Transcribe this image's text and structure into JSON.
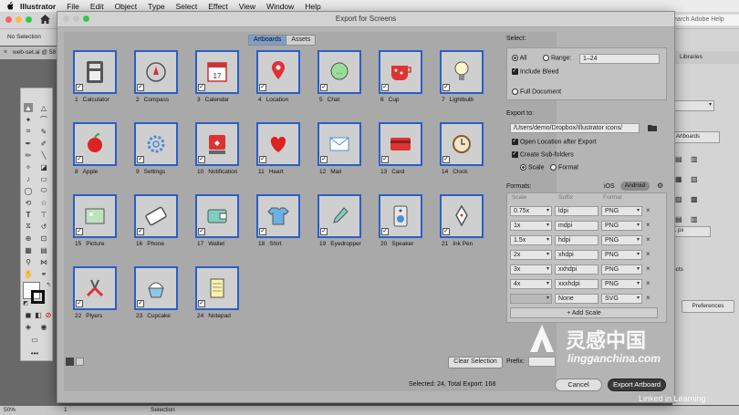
{
  "menubar": {
    "app_name": "Illustrator",
    "items": [
      "File",
      "Edit",
      "Object",
      "Type",
      "Select",
      "Effect",
      "View",
      "Window",
      "Help"
    ]
  },
  "appbar": {
    "search_placeholder": "earch Adobe Help"
  },
  "controlbar": {
    "selection_text": "No Selection"
  },
  "document_tab": {
    "label": "web-set.ai @ 58"
  },
  "rightpanel": {
    "libraries_label": "Libraries",
    "artboards_btn": "t Artboards",
    "px_value": "1 px",
    "ects_label": "ects",
    "preferences_btn": "Preferences"
  },
  "statusbar": {
    "zoom": "50%",
    "page": "1",
    "mode": "Selection"
  },
  "dialog": {
    "title": "Export for Screens",
    "tabs": [
      {
        "label": "Artboards",
        "active": true
      },
      {
        "label": "Assets",
        "active": false
      }
    ],
    "artboards": [
      {
        "num": "1",
        "name": "Calculator"
      },
      {
        "num": "2",
        "name": "Compass"
      },
      {
        "num": "3",
        "name": "Calendar"
      },
      {
        "num": "4",
        "name": "Location"
      },
      {
        "num": "5",
        "name": "Chat"
      },
      {
        "num": "6",
        "name": "Cup"
      },
      {
        "num": "7",
        "name": "Lightbulb"
      },
      {
        "num": "8",
        "name": "Apple"
      },
      {
        "num": "9",
        "name": "Settings"
      },
      {
        "num": "10",
        "name": "Notification"
      },
      {
        "num": "11",
        "name": "Heart"
      },
      {
        "num": "12",
        "name": "Mail"
      },
      {
        "num": "13",
        "name": "Card"
      },
      {
        "num": "14",
        "name": "Clock"
      },
      {
        "num": "15",
        "name": "Picture"
      },
      {
        "num": "16",
        "name": "Phone"
      },
      {
        "num": "17",
        "name": "Wallet"
      },
      {
        "num": "18",
        "name": "Shirt"
      },
      {
        "num": "19",
        "name": "Eyedropper"
      },
      {
        "num": "20",
        "name": "Speaker"
      },
      {
        "num": "21",
        "name": "Ink Pen"
      },
      {
        "num": "22",
        "name": "Plyers"
      },
      {
        "num": "23",
        "name": "Cupcake"
      },
      {
        "num": "24",
        "name": "Notepad"
      }
    ],
    "clear_selection": "Clear Selection",
    "select": {
      "heading": "Select:",
      "all_label": "All",
      "range_label": "Range:",
      "range_value": "1–24",
      "include_bleed": "Include Bleed",
      "full_document": "Full Document"
    },
    "export_to": {
      "heading": "Export to:",
      "path": "/Users/demo/Dropbox/Illustrator icons/",
      "open_location": "Open Location after Export",
      "create_subfolders": "Create Sub-folders",
      "scale_label": "Scale",
      "format_label": "Format"
    },
    "formats": {
      "heading": "Formats:",
      "ios_label": "iOS",
      "android_label": "Android",
      "col_scale": "Scale",
      "col_suffix": "Suffix",
      "col_format": "Format",
      "rows": [
        {
          "scale": "0.75x",
          "suffix": "ldpi",
          "format": "PNG"
        },
        {
          "scale": "1x",
          "suffix": "mdpi",
          "format": "PNG"
        },
        {
          "scale": "1.5x",
          "suffix": "hdpi",
          "format": "PNG"
        },
        {
          "scale": "2x",
          "suffix": "xhdpi",
          "format": "PNG"
        },
        {
          "scale": "3x",
          "suffix": "xxhdpi",
          "format": "PNG"
        },
        {
          "scale": "4x",
          "suffix": "xxxhdpi",
          "format": "PNG"
        },
        {
          "scale": "",
          "suffix": "None",
          "format": "SVG"
        }
      ],
      "add_scale": "Add Scale"
    },
    "prefix_label": "Prefix:",
    "status": "Selected: 24, Total Export: 168",
    "cancel": "Cancel",
    "export_btn": "Export Artboard"
  },
  "watermark": {
    "brand": "灵感中国",
    "url": "lingganchina.com",
    "linkedin": "Linked in Learning"
  }
}
